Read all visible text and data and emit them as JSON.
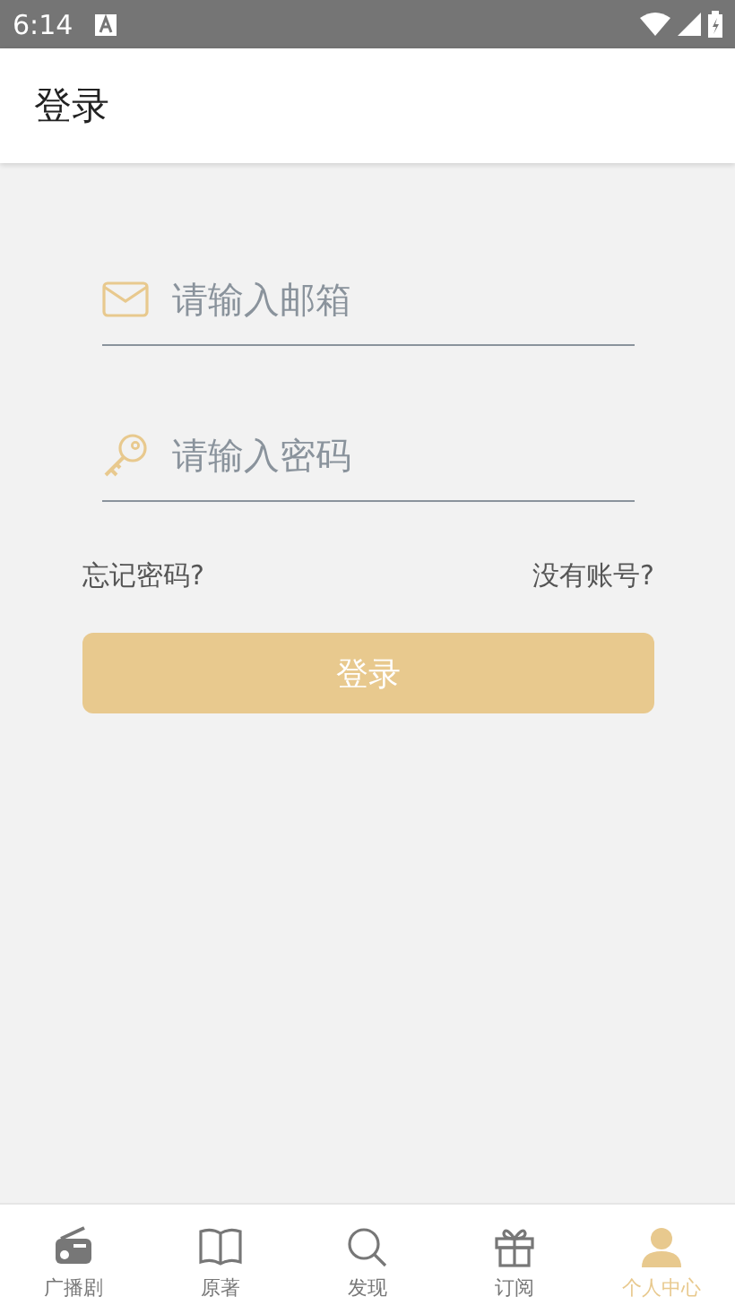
{
  "status_bar": {
    "time": "6:14"
  },
  "app_bar": {
    "title": "登录"
  },
  "form": {
    "email": {
      "placeholder": "请输入邮箱"
    },
    "password": {
      "placeholder": "请输入密码"
    },
    "forgot_link": "忘记密码?",
    "register_link": "没有账号?",
    "login_button": "登录"
  },
  "bottom_nav": [
    {
      "label": "广播剧",
      "selected": false
    },
    {
      "label": "原著",
      "selected": false
    },
    {
      "label": "发现",
      "selected": false
    },
    {
      "label": "订阅",
      "selected": false
    },
    {
      "label": "个人中心",
      "selected": true
    }
  ]
}
